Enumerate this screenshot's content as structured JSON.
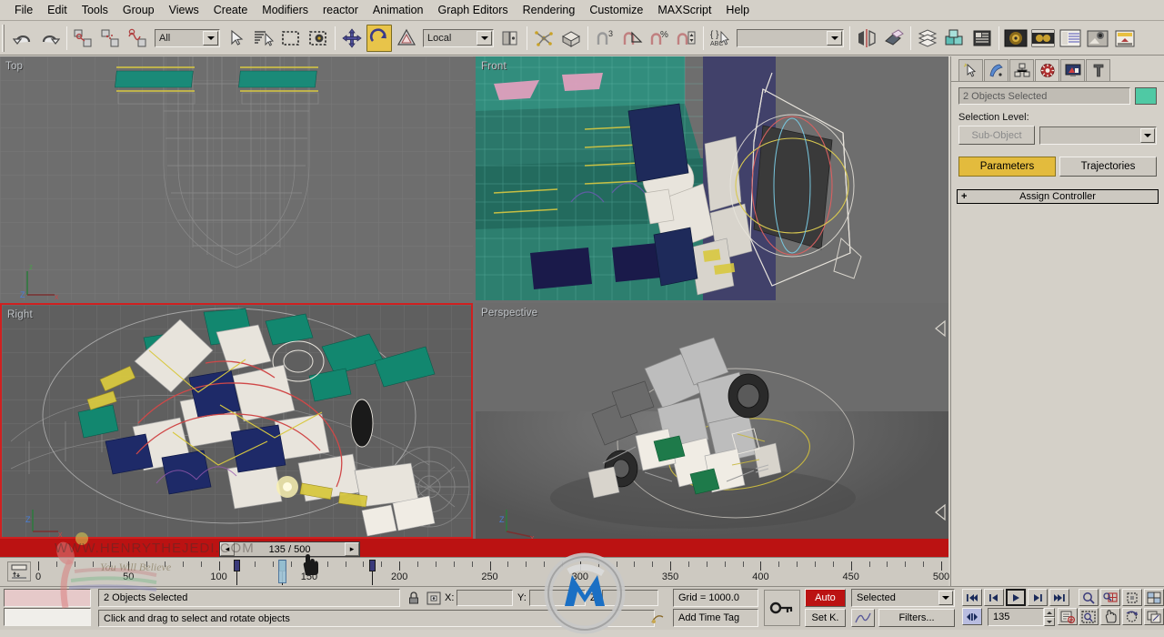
{
  "app": {
    "title": "3ds Max"
  },
  "menubar": {
    "items": [
      {
        "label": "File"
      },
      {
        "label": "Edit"
      },
      {
        "label": "Tools"
      },
      {
        "label": "Group"
      },
      {
        "label": "Views"
      },
      {
        "label": "Create"
      },
      {
        "label": "Modifiers"
      },
      {
        "label": "reactor"
      },
      {
        "label": "Animation"
      },
      {
        "label": "Graph Editors"
      },
      {
        "label": "Rendering"
      },
      {
        "label": "Customize"
      },
      {
        "label": "MAXScript"
      },
      {
        "label": "Help"
      }
    ]
  },
  "toolbar": {
    "selection_filter": {
      "value": "All",
      "icon": "chevron-down-icon"
    },
    "reference_coord": {
      "value": "Local",
      "icon": "chevron-down-icon"
    },
    "named_selection_sets": {
      "value": "",
      "placeholder": ""
    },
    "icons": [
      "undo-icon",
      "redo-icon",
      "select-link-icon",
      "unlink-icon",
      "bind-space-warp-icon",
      "select-object-icon",
      "select-by-name-icon",
      "rectangular-select-region-icon",
      "select-and-move-region-icon",
      "select-and-move-icon",
      "select-and-rotate-icon",
      "select-and-scale-icon",
      "use-pivot-center-icon",
      "align-icon",
      "array-icon",
      "angle-snap-icon",
      "percent-snap-icon",
      "spinner-snap-icon",
      "named-selection-icon",
      "mirror-icon",
      "align-tool-icon",
      "layer-manager-icon",
      "curve-editor-icon",
      "schematic-view-icon",
      "material-editor-icon",
      "render-setup-icon",
      "rendered-frame-window-icon",
      "render-production-icon",
      "render-iterative-icon"
    ],
    "snaps_value": "3",
    "active_tool": "select-and-rotate-icon"
  },
  "viewports": [
    {
      "name": "Top",
      "label": "Top",
      "active": false,
      "axes": [
        "Z",
        "X"
      ]
    },
    {
      "name": "Front",
      "label": "Front",
      "active": false,
      "axes": [
        "Z",
        "X"
      ]
    },
    {
      "name": "Right",
      "label": "Right",
      "active": true,
      "axes": [
        "Z",
        "X"
      ]
    },
    {
      "name": "Perspective",
      "label": "Perspective",
      "active": false,
      "axes": [
        "Z",
        "X"
      ]
    }
  ],
  "command_panel": {
    "tabs": [
      {
        "icon": "create-icon",
        "selected": false
      },
      {
        "icon": "modify-icon",
        "selected": false
      },
      {
        "icon": "hierarchy-icon",
        "selected": false
      },
      {
        "icon": "motion-icon",
        "selected": true
      },
      {
        "icon": "display-icon",
        "selected": false
      },
      {
        "icon": "utilities-icon",
        "selected": false
      }
    ],
    "object_name": "2 Objects Selected",
    "color_swatch": "#4fc9a4",
    "selection_level_label": "Selection Level:",
    "sub_object_button": "Sub-Object",
    "sub_object_dropdown": "",
    "parameters_button": "Parameters",
    "trajectories_button": "Trajectories",
    "rollout_assign_controller": "Assign Controller"
  },
  "timeslider": {
    "current_frame": "135",
    "total_frames": "500",
    "display": "135 / 500",
    "prev_icon": "chevron-left-icon",
    "next_icon": "chevron-right-icon"
  },
  "trackbar": {
    "tool_icon": "open-mini-curve-editor-icon",
    "ticks": [
      0,
      50,
      100,
      150,
      200,
      250,
      300,
      350,
      400,
      450,
      500
    ],
    "range_start": 0,
    "range_end": 500,
    "keys": [
      110,
      135,
      185
    ]
  },
  "statusbar": {
    "listener_top": "",
    "listener_bottom": "",
    "selection_status": "2 Objects Selected",
    "prompt": "Click and drag to select and rotate objects",
    "lock_icon": "selection-lock-icon",
    "absolute_icon": "absolute-relative-transform-icon",
    "coords": [
      {
        "label": "X:",
        "value": ""
      },
      {
        "label": "Y:",
        "value": ""
      },
      {
        "label": "Z:",
        "value": ""
      }
    ],
    "grid_text": "Grid = 1000.0",
    "add_time_tag": "Add Time Tag",
    "key_mode_icon": "key-mode-toggle-icon",
    "auto_key": "Auto",
    "set_key": "Set K.",
    "key_filters_dropdown": "Selected",
    "curve_icon": "default-in-out-tangents-icon",
    "filters_button": "Filters...",
    "playback": [
      {
        "icon": "go-to-start-icon"
      },
      {
        "icon": "previous-frame-icon"
      },
      {
        "icon": "play-animation-icon"
      },
      {
        "icon": "next-frame-icon"
      },
      {
        "icon": "go-to-end-icon"
      }
    ],
    "key_mode_toggle_icon": "key-mode-toggle-icon",
    "frame_field": "135",
    "time_config_icon": "time-configuration-icon",
    "nav_icons": [
      "zoom-icon",
      "zoom-all-icon",
      "zoom-extents-icon",
      "zoom-extents-all-icon",
      "region-zoom-icon",
      "pan-view-icon",
      "arc-rotate-icon",
      "maximize-viewport-toggle-icon"
    ]
  },
  "watermark": {
    "text": "WWW.HENRYTHEJEDI.COM",
    "subtext": "You Will Believe",
    "logo": "figure-logo"
  },
  "colors": {
    "accent_yellow": "#e3bb3d",
    "auto_key_red": "#bb1212",
    "active_viewport_border": "#cf2020",
    "swatch_teal": "#4fc9a4",
    "panel_bg": "#d4d0c8"
  }
}
